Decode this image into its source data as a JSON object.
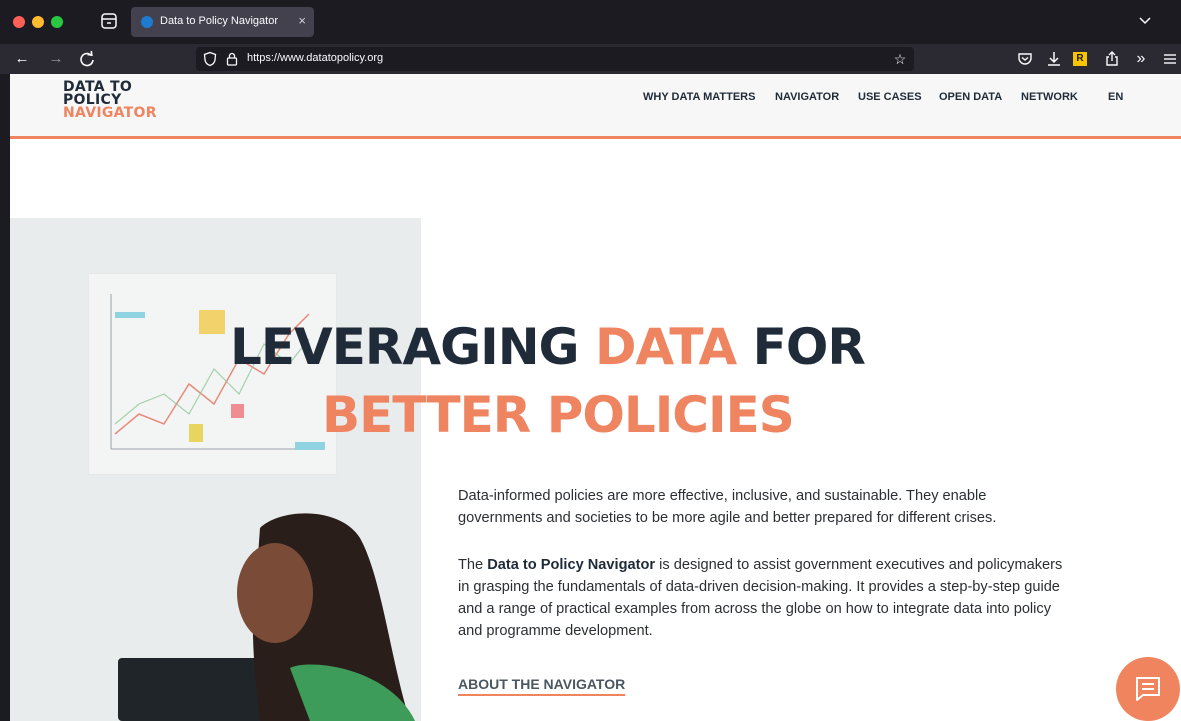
{
  "browser": {
    "tab_title": "Data to Policy Navigator",
    "tab_close": "×",
    "url": "https://www.datatopolicy.org",
    "icons": [
      "tabs-overview-icon",
      "back-icon",
      "forward-icon",
      "reload-icon",
      "shield-icon",
      "lock-icon",
      "star-icon",
      "pocket-icon",
      "download-icon",
      "extension-r-icon",
      "share-icon",
      "overflow-icon",
      "menu-icon",
      "tab-list-icon"
    ]
  },
  "site": {
    "logo": {
      "line1": "DATA TO",
      "line2": "POLICY",
      "line3": "NAVIGATOR"
    },
    "nav": [
      "WHY DATA MATTERS",
      "NAVIGATOR",
      "USE CASES",
      "OPEN DATA",
      "NETWORK"
    ],
    "lang": "EN",
    "headline": {
      "part1": "LEVERAGING ",
      "accent": "DATA",
      "part2": " FOR",
      "line2": "BETTER POLICIES"
    },
    "intro": "Data-informed policies are more effective, inclusive, and sustainable. They enable governments and societies to be more agile and better prepared for different crises.",
    "desc_prefix": "The ",
    "desc_bold": "Data to Policy Navigator",
    "desc_rest": " is designed to assist government executives and policymakers in grasping the fundamentals of data-driven decision-making. It provides a step-by-step guide and a range of practical examples from across the globe on how to integrate data into policy and programme development.",
    "about_link": "ABOUT THE NAVIGATOR",
    "chat_icon": "chat-icon"
  },
  "colors": {
    "accent": "#ef8460",
    "navy": "#1f2b38",
    "chrome_dark": "#1c1b22",
    "chrome_nav": "#2b2a33"
  }
}
